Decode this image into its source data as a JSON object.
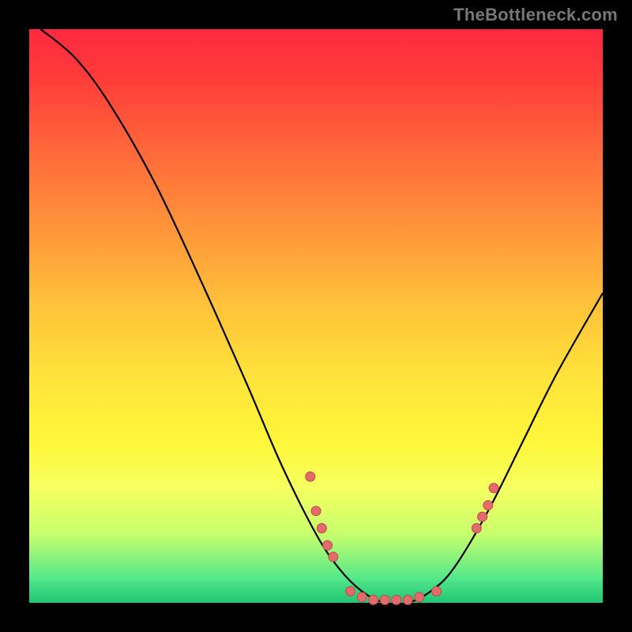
{
  "watermark": "TheBottleneck.com",
  "chart_data": {
    "type": "line",
    "title": "",
    "xlabel": "",
    "ylabel": "",
    "xlim": [
      0,
      100
    ],
    "ylim": [
      0,
      100
    ],
    "curve": [
      {
        "x": 2,
        "y": 100
      },
      {
        "x": 8,
        "y": 95
      },
      {
        "x": 14,
        "y": 87
      },
      {
        "x": 22,
        "y": 73
      },
      {
        "x": 30,
        "y": 56
      },
      {
        "x": 38,
        "y": 38
      },
      {
        "x": 44,
        "y": 24
      },
      {
        "x": 50,
        "y": 12
      },
      {
        "x": 54,
        "y": 6
      },
      {
        "x": 58,
        "y": 2
      },
      {
        "x": 62,
        "y": 0
      },
      {
        "x": 66,
        "y": 0
      },
      {
        "x": 70,
        "y": 2
      },
      {
        "x": 74,
        "y": 6
      },
      {
        "x": 80,
        "y": 16
      },
      {
        "x": 86,
        "y": 28
      },
      {
        "x": 92,
        "y": 40
      },
      {
        "x": 100,
        "y": 54
      }
    ],
    "points": [
      {
        "x": 49,
        "y": 22
      },
      {
        "x": 50,
        "y": 16
      },
      {
        "x": 51,
        "y": 13
      },
      {
        "x": 52,
        "y": 10
      },
      {
        "x": 53,
        "y": 8
      },
      {
        "x": 56,
        "y": 2
      },
      {
        "x": 58,
        "y": 1
      },
      {
        "x": 60,
        "y": 0.5
      },
      {
        "x": 62,
        "y": 0.5
      },
      {
        "x": 64,
        "y": 0.5
      },
      {
        "x": 66,
        "y": 0.5
      },
      {
        "x": 68,
        "y": 1
      },
      {
        "x": 71,
        "y": 2
      },
      {
        "x": 78,
        "y": 13
      },
      {
        "x": 79,
        "y": 15
      },
      {
        "x": 80,
        "y": 17
      },
      {
        "x": 81,
        "y": 20
      }
    ],
    "point_radius": 6
  }
}
